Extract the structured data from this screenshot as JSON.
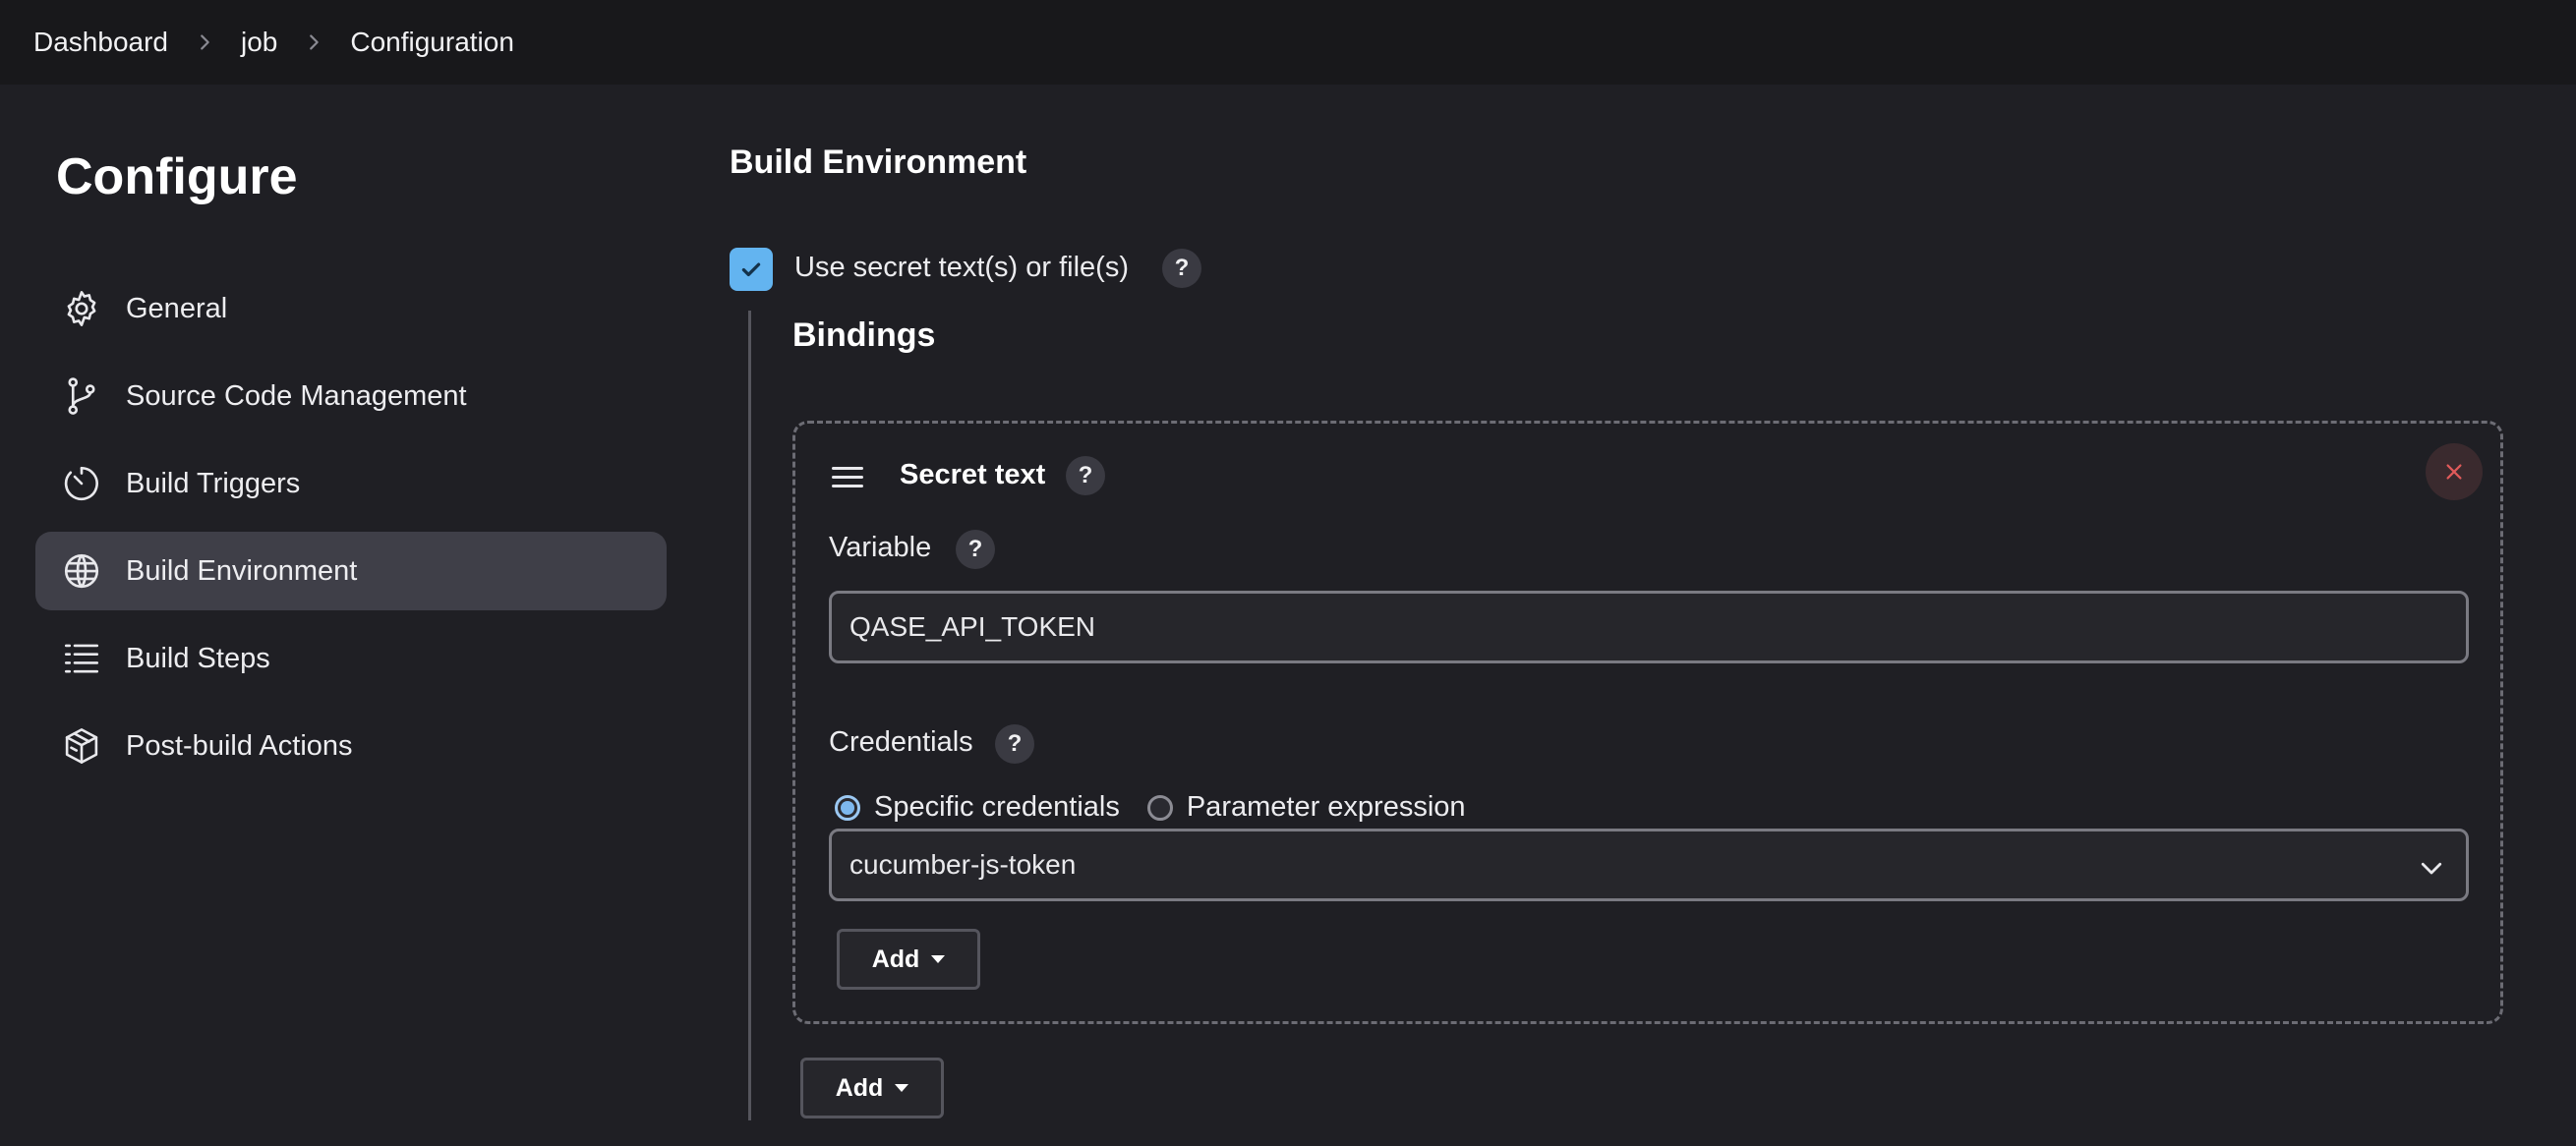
{
  "breadcrumb": {
    "items": [
      "Dashboard",
      "job",
      "Configuration"
    ]
  },
  "sidebar": {
    "title": "Configure",
    "items": [
      {
        "label": "General",
        "icon": "gear-icon",
        "active": false
      },
      {
        "label": "Source Code Management",
        "icon": "git-branch-icon",
        "active": false
      },
      {
        "label": "Build Triggers",
        "icon": "timer-icon",
        "active": false
      },
      {
        "label": "Build Environment",
        "icon": "globe-icon",
        "active": true
      },
      {
        "label": "Build Steps",
        "icon": "list-icon",
        "active": false
      },
      {
        "label": "Post-build Actions",
        "icon": "package-icon",
        "active": false
      }
    ]
  },
  "main": {
    "section_title": "Build Environment",
    "secret_checkbox": {
      "label": "Use secret text(s) or file(s)",
      "checked": true,
      "help": "?"
    },
    "bindings": {
      "title": "Bindings",
      "card": {
        "title": "Secret text",
        "help": "?",
        "variable": {
          "label": "Variable",
          "help": "?",
          "value": "QASE_API_TOKEN"
        },
        "credentials": {
          "label": "Credentials",
          "help": "?",
          "options": [
            "Specific credentials",
            "Parameter expression"
          ],
          "selected_option": "Specific credentials",
          "selected_value": "cucumber-js-token",
          "add_label": "Add"
        }
      },
      "add_label": "Add"
    }
  },
  "colors": {
    "accent": "#63b4f0",
    "background": "#1f1f24",
    "active_nav": "#3f3f48",
    "close": "#e05a5a"
  }
}
